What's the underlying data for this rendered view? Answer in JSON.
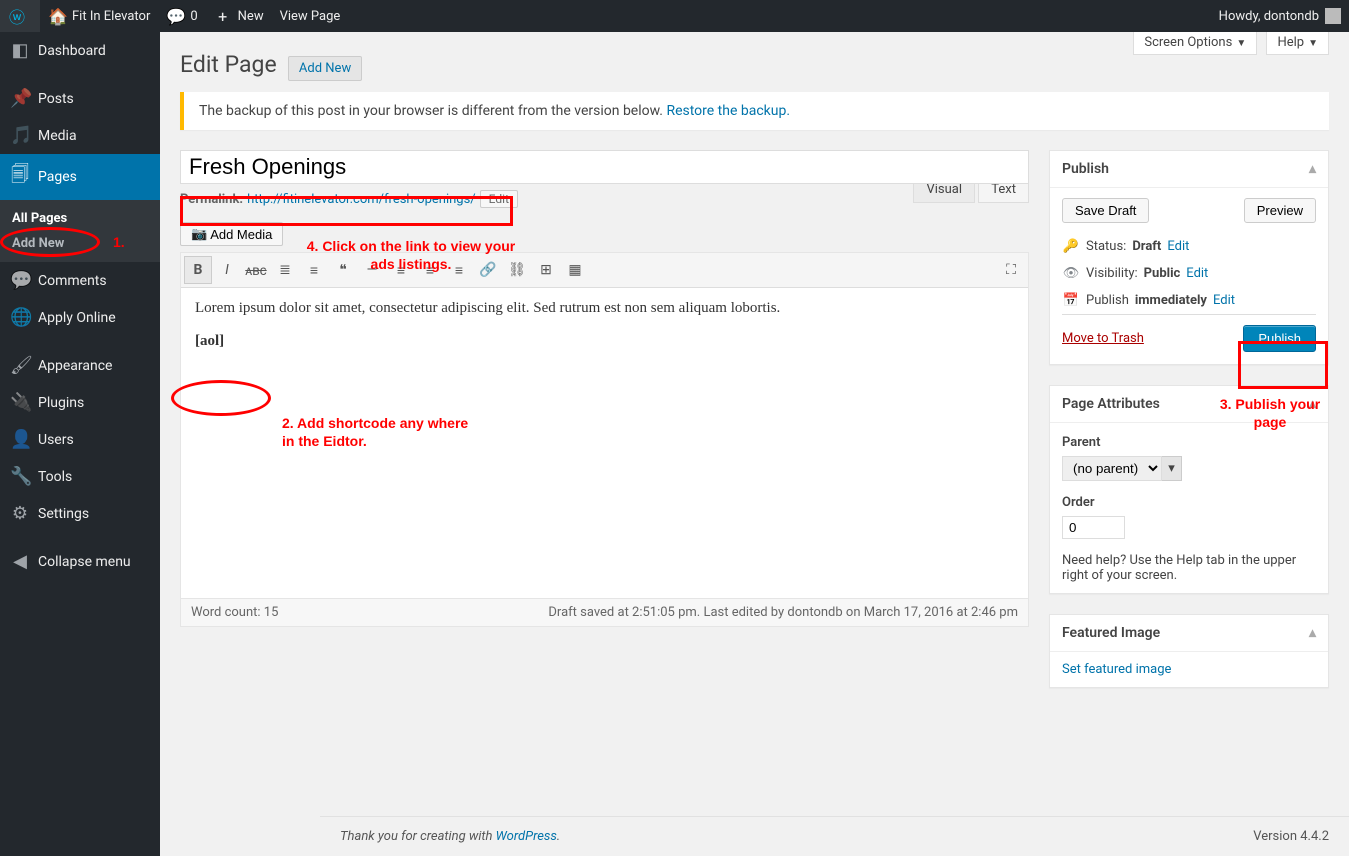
{
  "adminbar": {
    "site_name": "Fit In Elevator",
    "comments_count": "0",
    "new_label": "New",
    "view_page": "View Page",
    "howdy": "Howdy, dontondb"
  },
  "sidebar": {
    "items": [
      {
        "label": "Dashboard",
        "icon": "⌂"
      },
      {
        "label": "Posts",
        "icon": "📌"
      },
      {
        "label": "Media",
        "icon": "🎵"
      },
      {
        "label": "Pages",
        "icon": "📄",
        "current": true
      },
      {
        "label": "Comments",
        "icon": "💬"
      },
      {
        "label": "Apply Online",
        "icon": "🌐"
      },
      {
        "label": "Appearance",
        "icon": "🖌"
      },
      {
        "label": "Plugins",
        "icon": "🔌"
      },
      {
        "label": "Users",
        "icon": "👤"
      },
      {
        "label": "Tools",
        "icon": "🔧"
      },
      {
        "label": "Settings",
        "icon": "⚙"
      },
      {
        "label": "Collapse menu",
        "icon": "◀"
      }
    ],
    "submenu": {
      "all_pages": "All Pages",
      "add_new": "Add New"
    }
  },
  "screen_meta": {
    "screen_options": "Screen Options",
    "help": "Help"
  },
  "header": {
    "title": "Edit Page",
    "add_new": "Add New"
  },
  "notice": {
    "text": "The backup of this post in your browser is different from the version below. ",
    "link": "Restore the backup."
  },
  "post": {
    "title_value": "Fresh Openings",
    "permalink_label": "Permalink:",
    "permalink_url": "http://fitinelevator.com/fresh-openings/",
    "edit_btn": "Edit",
    "add_media": "Add Media",
    "tabs": {
      "visual": "Visual",
      "text": "Text"
    },
    "content_p1": "Lorem ipsum dolor sit amet, consectetur adipiscing elit. Sed rutrum est non sem aliquam lobortis.",
    "content_shortcode": "[aol]",
    "word_count_label": "Word count: 15",
    "status_text": "Draft saved at 2:51:05 pm. Last edited by dontondb on March 17, 2016 at 2:46 pm"
  },
  "publish_box": {
    "title": "Publish",
    "save_draft": "Save Draft",
    "preview": "Preview",
    "status_label": "Status:",
    "status_value": "Draft",
    "visibility_label": "Visibility:",
    "visibility_value": "Public",
    "publish_label": "Publish",
    "publish_value": "immediately",
    "edit_link": "Edit",
    "trash": "Move to Trash",
    "publish_btn": "Publish"
  },
  "attributes_box": {
    "title": "Page Attributes",
    "parent_label": "Parent",
    "parent_value": "(no parent)",
    "order_label": "Order",
    "order_value": "0",
    "help_text": "Need help? Use the Help tab in the upper right of your screen."
  },
  "featured_image_box": {
    "title": "Featured Image",
    "link": "Set featured image"
  },
  "footer": {
    "thank_you_prefix": "Thank you for creating with ",
    "wp_link": "WordPress",
    "version": "Version 4.4.2"
  },
  "annotations": {
    "n1": "1.",
    "n2": "2. Add shortcode any where in the Eidtor.",
    "n3": "3. Publish your page",
    "n4": "4. Click on the link to view your ads listings."
  }
}
